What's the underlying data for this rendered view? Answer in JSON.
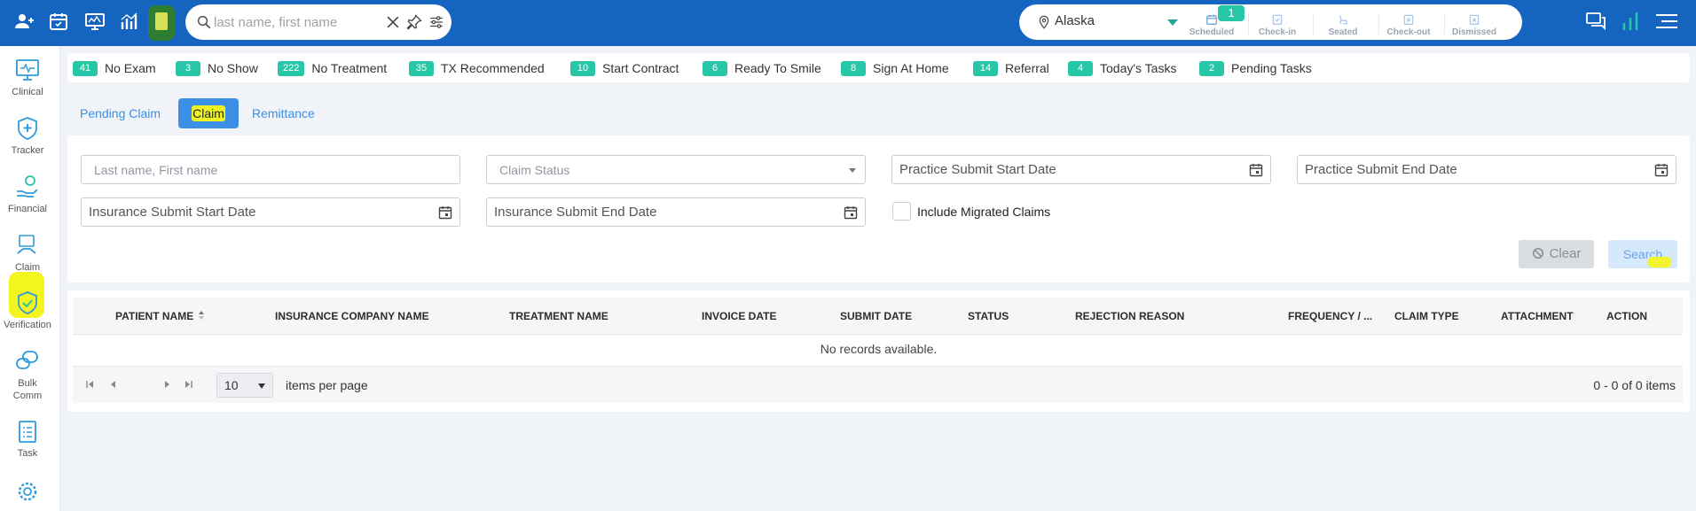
{
  "topbar": {
    "search": {
      "placeholder": "last name, first name"
    },
    "location": "Alaska",
    "statuses": [
      {
        "label": "Scheduled",
        "badge": "1"
      },
      {
        "label": "Check-in"
      },
      {
        "label": "Seated"
      },
      {
        "label": "Check-out"
      },
      {
        "label": "Dismissed"
      }
    ]
  },
  "sidebar": {
    "items": [
      {
        "label": "Clinical"
      },
      {
        "label": "Tracker"
      },
      {
        "label": "Financial"
      },
      {
        "label": "Claim"
      },
      {
        "label": "Verification"
      },
      {
        "label": "Bulk Comm"
      },
      {
        "label": "Task"
      }
    ]
  },
  "counters": [
    {
      "count": "41",
      "label": "No Exam"
    },
    {
      "count": "3",
      "label": "No Show"
    },
    {
      "count": "222",
      "label": "No Treatment"
    },
    {
      "count": "35",
      "label": "TX Recommended"
    },
    {
      "count": "10",
      "label": "Start Contract"
    },
    {
      "count": "6",
      "label": "Ready To Smile"
    },
    {
      "count": "8",
      "label": "Sign At Home"
    },
    {
      "count": "14",
      "label": "Referral"
    },
    {
      "count": "4",
      "label": "Today's Tasks"
    },
    {
      "count": "2",
      "label": "Pending Tasks"
    }
  ],
  "tabs": [
    {
      "label": "Pending Claim"
    },
    {
      "label": "Claim"
    },
    {
      "label": "Remittance"
    }
  ],
  "filters": {
    "name_placeholder": "Last name, First name",
    "claim_status_placeholder": "Claim Status",
    "practice_start_placeholder": "Practice Submit Start Date",
    "practice_end_placeholder": "Practice Submit End Date",
    "insurance_start_placeholder": "Insurance Submit Start Date",
    "insurance_end_placeholder": "Insurance Submit End Date",
    "include_migrated_label": "Include Migrated Claims",
    "clear_label": "Clear",
    "search_label": "Search"
  },
  "grid": {
    "columns": [
      "PATIENT NAME",
      "INSURANCE COMPANY NAME",
      "TREATMENT NAME",
      "INVOICE DATE",
      "SUBMIT DATE",
      "STATUS",
      "REJECTION REASON",
      "FREQUENCY / ...",
      "CLAIM TYPE",
      "ATTACHMENT",
      "ACTION"
    ],
    "empty_text": "No records available.",
    "page_size": "10",
    "items_per_page_label": "items per page",
    "items_info": "0 - 0 of 0 items"
  },
  "colors": {
    "topbar": "#1565c0",
    "accent": "#26c6a6",
    "link": "#3b8fe6",
    "highlight": "#f4f41e"
  }
}
